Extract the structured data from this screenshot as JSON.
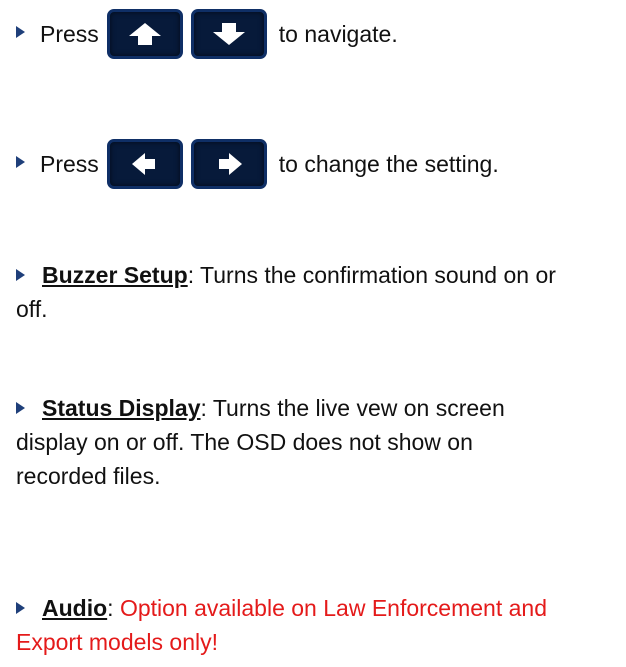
{
  "nav": {
    "press_label": "Press",
    "navigate_text": "to navigate.",
    "up_key_icon": "arrow-up-icon",
    "down_key_icon": "arrow-down-icon"
  },
  "change": {
    "press_label": "Press",
    "change_text": "to change the setting.",
    "left_key_icon": "arrow-left-icon",
    "right_key_icon": "arrow-right-icon"
  },
  "items": [
    {
      "term": "Buzzer Setup",
      "description": ": Turns the confirmation sound on or off."
    },
    {
      "term": "Status Display",
      "description": ": Turns the live vew on screen display on or off. The OSD does not show on recorded files."
    },
    {
      "term": "Audio",
      "description_prefix": ": ",
      "description": "Option available on Law Enforcement and Export models only!"
    }
  ],
  "colors": {
    "bullet": "#1f3f7a",
    "key_fill": "#071a3a",
    "key_border": "#0f2f66",
    "warning_text": "#e41a1a"
  }
}
